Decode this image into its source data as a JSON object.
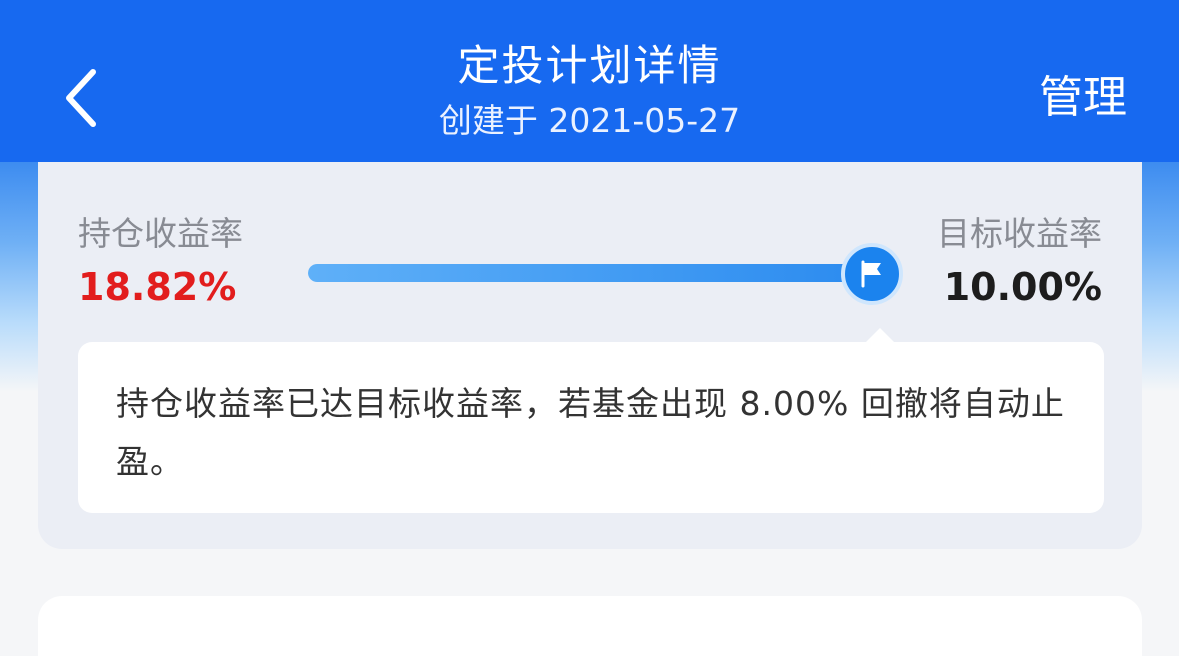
{
  "header": {
    "title": "定投计划详情",
    "subtitle": "创建于 2021-05-27",
    "manage_label": "管理",
    "back_icon": "chevron-left-icon",
    "background_color": "#1769f0"
  },
  "profit_card": {
    "holding_yield_label": "持仓收益率",
    "holding_yield_value": "18.82%",
    "target_yield_label": "目标收益率",
    "target_yield_value": "10.00%",
    "progress_fraction": 1.0,
    "flag_icon": "flag-icon",
    "notice_text": "持仓收益率已达目标收益率，若基金出现 8.00% 回撤将自动止盈。",
    "accent_color": "#1b83ee",
    "profit_color": "#e21d1d"
  }
}
